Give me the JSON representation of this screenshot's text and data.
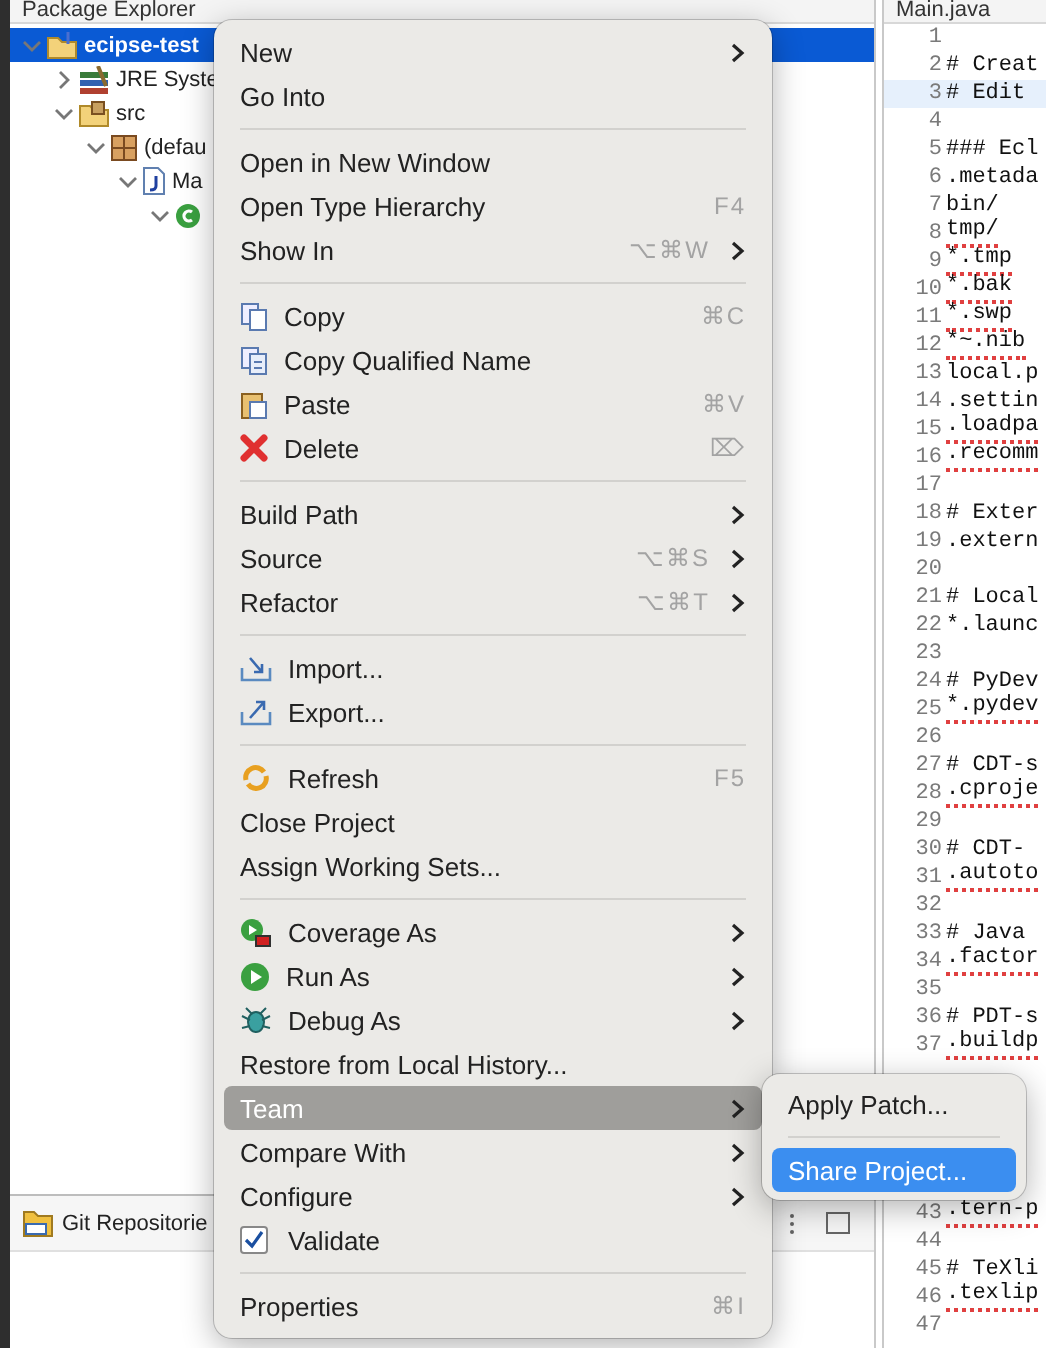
{
  "explorer": {
    "tab": "Package Explorer",
    "tree": [
      {
        "kind": "project",
        "label": "ecipse-test",
        "expanded": true,
        "selected": true,
        "children": [
          {
            "kind": "library",
            "label": "JRE Syste",
            "expanded": false,
            "selected": false
          },
          {
            "kind": "source-folder",
            "label": "src",
            "expanded": true,
            "selected": false,
            "children": [
              {
                "kind": "package",
                "label": "(defau",
                "expanded": true,
                "selected": false,
                "children": [
                  {
                    "kind": "file",
                    "label": "Ma",
                    "expanded": true,
                    "selected": false,
                    "children": [
                      {
                        "kind": "class",
                        "expanded": true,
                        "selected": false
                      }
                    ]
                  }
                ]
              }
            ]
          }
        ]
      }
    ]
  },
  "git_panel": {
    "title": "Git Repositorie"
  },
  "editor": {
    "tab": "Main.java",
    "lines": [
      {
        "kind": "line",
        "number": "1",
        "selected": false
      },
      {
        "kind": "line",
        "number": "2",
        "text": "# Creat",
        "selected": false,
        "misspelled": false
      },
      {
        "kind": "line",
        "number": "3",
        "text": "# Edit",
        "selected": true,
        "misspelled": false
      },
      {
        "kind": "line",
        "number": "4",
        "selected": false
      },
      {
        "kind": "line",
        "number": "5",
        "text": "### Ecl",
        "selected": false,
        "misspelled": false
      },
      {
        "kind": "line",
        "number": "6",
        "text": ".metada",
        "selected": false,
        "misspelled": false
      },
      {
        "kind": "line",
        "number": "7",
        "text": "bin/",
        "selected": false,
        "misspelled": false
      },
      {
        "kind": "line",
        "number": "8",
        "text": "tmp/",
        "selected": false,
        "misspelled": true
      },
      {
        "kind": "line",
        "number": "9",
        "text": "*.tmp",
        "selected": false,
        "misspelled": true
      },
      {
        "kind": "line",
        "number": "10",
        "text": "*.bak",
        "selected": false,
        "misspelled": true
      },
      {
        "kind": "line",
        "number": "11",
        "text": "*.swp",
        "selected": false,
        "misspelled": true
      },
      {
        "kind": "line",
        "number": "12",
        "text": "*~.nib",
        "selected": false,
        "misspelled": true
      },
      {
        "kind": "line",
        "number": "13",
        "text": "local.p",
        "selected": false,
        "misspelled": false
      },
      {
        "kind": "line",
        "number": "14",
        "text": ".settin",
        "selected": false,
        "misspelled": false
      },
      {
        "kind": "line",
        "number": "15",
        "text": ".loadpa",
        "selected": false,
        "misspelled": true
      },
      {
        "kind": "line",
        "number": "16",
        "text": ".recomm",
        "selected": false,
        "misspelled": true
      },
      {
        "kind": "line",
        "number": "17",
        "selected": false
      },
      {
        "kind": "line",
        "number": "18",
        "text": "# Exter",
        "selected": false,
        "misspelled": false
      },
      {
        "kind": "line",
        "number": "19",
        "text": ".extern",
        "selected": false,
        "misspelled": false
      },
      {
        "kind": "line",
        "number": "20",
        "selected": false
      },
      {
        "kind": "line",
        "number": "21",
        "text": "# Local",
        "selected": false,
        "misspelled": false
      },
      {
        "kind": "line",
        "number": "22",
        "text": "*.launc",
        "selected": false,
        "misspelled": false
      },
      {
        "kind": "line",
        "number": "23",
        "selected": false
      },
      {
        "kind": "line",
        "number": "24",
        "text": "# PyDev",
        "selected": false,
        "misspelled": false
      },
      {
        "kind": "line",
        "number": "25",
        "text": "*.pydev",
        "selected": false,
        "misspelled": true
      },
      {
        "kind": "line",
        "number": "26",
        "selected": false
      },
      {
        "kind": "line",
        "number": "27",
        "text": "# CDT-s",
        "selected": false,
        "misspelled": false
      },
      {
        "kind": "line",
        "number": "28",
        "text": ".cproje",
        "selected": false,
        "misspelled": true
      },
      {
        "kind": "line",
        "number": "29",
        "selected": false
      },
      {
        "kind": "line",
        "number": "30",
        "text": "# CDT-",
        "selected": false,
        "misspelled": false
      },
      {
        "kind": "line",
        "number": "31",
        "text": ".autoto",
        "selected": false,
        "misspelled": true
      },
      {
        "kind": "line",
        "number": "32",
        "selected": false
      },
      {
        "kind": "line",
        "number": "33",
        "text": "# Java",
        "selected": false,
        "misspelled": false
      },
      {
        "kind": "line",
        "number": "34",
        "text": ".factor",
        "selected": false,
        "misspelled": true
      },
      {
        "kind": "line",
        "number": "35",
        "selected": false
      },
      {
        "kind": "line",
        "number": "36",
        "text": "# PDT-s",
        "selected": false,
        "misspelled": false
      },
      {
        "kind": "line",
        "number": "37",
        "text": ".buildp",
        "selected": false,
        "misspelled": true
      },
      {
        "kind": "covered"
      },
      {
        "kind": "covered"
      },
      {
        "kind": "covered"
      },
      {
        "kind": "covered"
      },
      {
        "kind": "covered"
      },
      {
        "kind": "line",
        "number": "43",
        "text": ".tern-p",
        "selected": false,
        "misspelled": true
      },
      {
        "kind": "line",
        "number": "44",
        "selected": false
      },
      {
        "kind": "line",
        "number": "45",
        "text": "# TeXli",
        "selected": false,
        "misspelled": false
      },
      {
        "kind": "line",
        "number": "46",
        "text": ".texlip",
        "selected": false,
        "misspelled": true
      },
      {
        "kind": "line",
        "number": "47",
        "selected": false
      }
    ]
  },
  "context_menu": {
    "items": [
      {
        "kind": "item",
        "label": "New",
        "submenu": true,
        "selected": false
      },
      {
        "kind": "item",
        "label": "Go Into",
        "submenu": false,
        "selected": false
      },
      {
        "kind": "separator"
      },
      {
        "kind": "item",
        "label": "Open in New Window",
        "submenu": false,
        "selected": false
      },
      {
        "kind": "item",
        "label": "Open Type Hierarchy",
        "shortcut": "F4",
        "submenu": false,
        "selected": false
      },
      {
        "kind": "item",
        "label": "Show In",
        "shortcut": "⌥⌘W",
        "submenu": true,
        "selected": false
      },
      {
        "kind": "separator"
      },
      {
        "kind": "item",
        "label": "Copy",
        "shortcut": "⌘C",
        "submenu": false,
        "selected": false
      },
      {
        "kind": "item",
        "label": "Copy Qualified Name",
        "submenu": false,
        "selected": false
      },
      {
        "kind": "item",
        "label": "Paste",
        "shortcut": "⌘V",
        "submenu": false,
        "selected": false
      },
      {
        "kind": "item",
        "label": "Delete",
        "shortcut": "⌦",
        "submenu": false,
        "selected": false
      },
      {
        "kind": "separator"
      },
      {
        "kind": "item",
        "label": "Build Path",
        "submenu": true,
        "selected": false
      },
      {
        "kind": "item",
        "label": "Source",
        "shortcut": "⌥⌘S",
        "submenu": true,
        "selected": false
      },
      {
        "kind": "item",
        "label": "Refactor",
        "shortcut": "⌥⌘T",
        "submenu": true,
        "selected": false
      },
      {
        "kind": "separator"
      },
      {
        "kind": "item",
        "label": "Import...",
        "submenu": false,
        "selected": false
      },
      {
        "kind": "item",
        "label": "Export...",
        "submenu": false,
        "selected": false
      },
      {
        "kind": "separator"
      },
      {
        "kind": "item",
        "label": "Refresh",
        "shortcut": "F5",
        "submenu": false,
        "selected": false
      },
      {
        "kind": "item",
        "label": "Close Project",
        "submenu": false,
        "selected": false
      },
      {
        "kind": "item",
        "label": "Assign Working Sets...",
        "submenu": false,
        "selected": false
      },
      {
        "kind": "separator"
      },
      {
        "kind": "item",
        "label": "Coverage As",
        "submenu": true,
        "selected": false
      },
      {
        "kind": "item",
        "label": "Run As",
        "submenu": true,
        "selected": false
      },
      {
        "kind": "item",
        "label": "Debug As",
        "submenu": true,
        "selected": false
      },
      {
        "kind": "item",
        "label": "Restore from Local History...",
        "submenu": false,
        "selected": false
      },
      {
        "kind": "item",
        "label": "Team",
        "submenu": true,
        "selected": true
      },
      {
        "kind": "item",
        "label": "Compare With",
        "submenu": true,
        "selected": false
      },
      {
        "kind": "item",
        "label": "Configure",
        "submenu": true,
        "selected": false
      },
      {
        "kind": "checkbox",
        "label": "Validate",
        "checked": true,
        "submenu": false,
        "selected": false
      },
      {
        "kind": "separator"
      },
      {
        "kind": "item",
        "label": "Properties",
        "shortcut": "⌘I",
        "submenu": false,
        "selected": false
      }
    ]
  },
  "submenu": {
    "items": [
      {
        "kind": "item",
        "label": "Apply Patch...",
        "selected": false
      },
      {
        "kind": "separator"
      },
      {
        "kind": "item",
        "label": "Share Project...",
        "selected": true
      }
    ]
  }
}
